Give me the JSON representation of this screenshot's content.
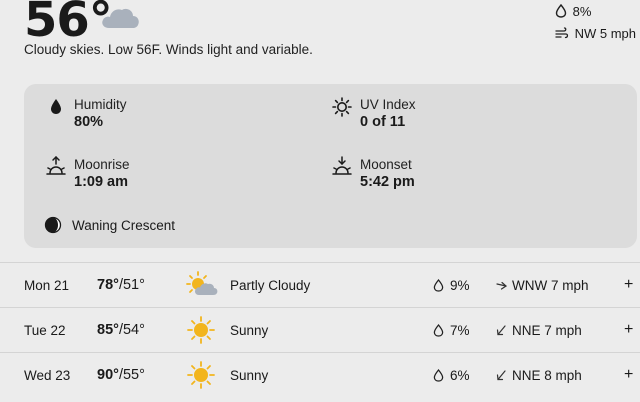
{
  "current": {
    "temperature": "56°",
    "condition_icon": "cloud-icon",
    "description": "Cloudy skies. Low 56F. Winds light and variable.",
    "precip": "8%",
    "wind": "NW 5 mph"
  },
  "details": {
    "humidity_label": "Humidity",
    "humidity_value": "80%",
    "uv_label": "UV Index",
    "uv_value": "0 of 11",
    "moonrise_label": "Moonrise",
    "moonrise_value": "1:09 am",
    "moonset_label": "Moonset",
    "moonset_value": "5:42 pm",
    "moon_phase": "Waning Crescent"
  },
  "forecast": [
    {
      "day": "Mon 21",
      "high": "78°",
      "low": "51°",
      "icon": "partly-cloudy-icon",
      "condition": "Partly Cloudy",
      "precip": "9%",
      "wind": "WNW 7 mph",
      "expand": "+"
    },
    {
      "day": "Tue 22",
      "high": "85°",
      "low": "54°",
      "icon": "sunny-icon",
      "condition": "Sunny",
      "precip": "7%",
      "wind": "NNE 7 mph",
      "expand": "+"
    },
    {
      "day": "Wed 23",
      "high": "90°",
      "low": "55°",
      "icon": "sunny-icon",
      "condition": "Sunny",
      "precip": "6%",
      "wind": "NNE 8 mph",
      "expand": "+"
    }
  ],
  "colors": {
    "sun": "#f2b51d",
    "cloud": "#a9b1bc",
    "card": "#dcdcdc",
    "background": "#ececec"
  }
}
